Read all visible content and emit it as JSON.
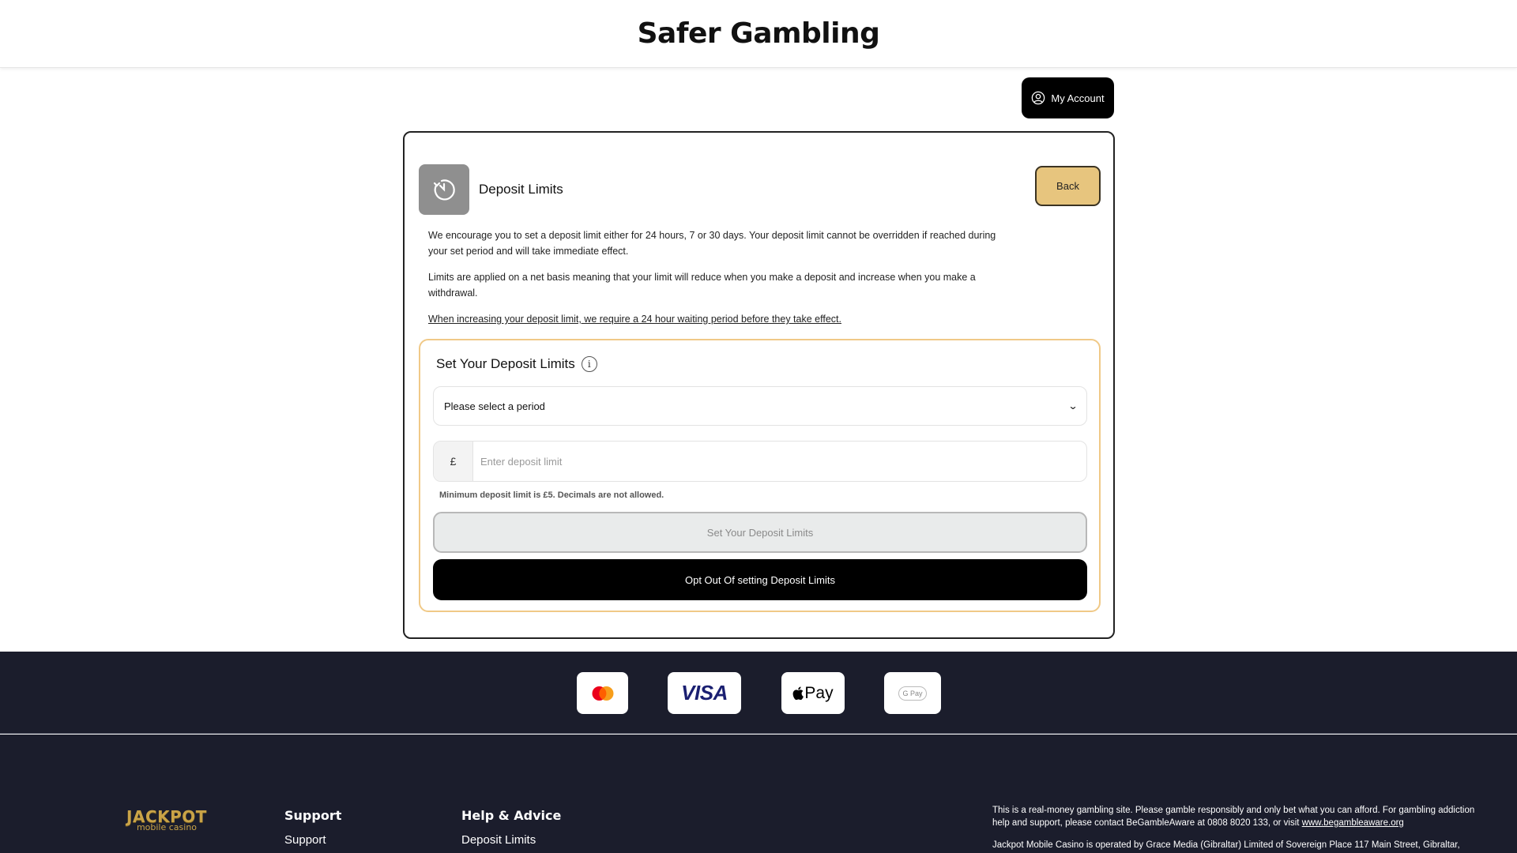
{
  "header": {
    "title": "Safer Gambling"
  },
  "account": {
    "label": "My Account"
  },
  "card": {
    "title": "Deposit Limits",
    "back_label": "Back",
    "paragraphs": [
      "We encourage you to set a deposit limit either for 24 hours, 7 or 30 days. Your deposit limit cannot be overridden if reached during your set period and will take immediate effect.",
      "Limits are applied on a net basis meaning that your limit will reduce when you make a deposit and increase when you make a withdrawal.",
      "When increasing your deposit limit, we require a 24 hour waiting period before they take effect."
    ]
  },
  "limits": {
    "title": "Set Your Deposit Limits",
    "info_glyph": "i",
    "period_select": {
      "value": "Please select a period"
    },
    "currency_symbol": "£",
    "amount": {
      "placeholder": "Enter deposit limit",
      "value": ""
    },
    "hint": "Minimum deposit limit is £5. Decimals are not allowed.",
    "set_button": "Set Your Deposit Limits",
    "optout_button": "Opt Out Of setting Deposit Limits"
  },
  "payments": {
    "icons": [
      "mastercard-icon",
      "visa-icon",
      "apple-pay-icon",
      "google-pay-icon"
    ],
    "visa_text": "VISA",
    "apple_pay_text": "Pay",
    "google_pay_text": "G Pay"
  },
  "footer": {
    "logo": {
      "line1": "JACKPOT",
      "line2": "mobile casino"
    },
    "support": {
      "heading": "Support",
      "links": [
        "Support"
      ]
    },
    "help": {
      "heading": "Help & Advice",
      "links": [
        "Deposit Limits"
      ]
    },
    "legal": {
      "p1_text": "This is a real-money gambling site. Please gamble responsibly and only bet what you can afford. For gambling addiction help and support, please contact BeGambleAware at 0808 8020 133, or visit ",
      "p1_link": "www.begambleaware.org",
      "p2_text": "Jackpot Mobile Casino is operated by Grace Media (Gibraltar) Limited of Sovereign Place 117 Main Street, Gibraltar,"
    }
  },
  "colors": {
    "accent_gold": "#e7c57e",
    "footer_bg": "#1b1d2c",
    "limits_border": "#f0c987"
  }
}
